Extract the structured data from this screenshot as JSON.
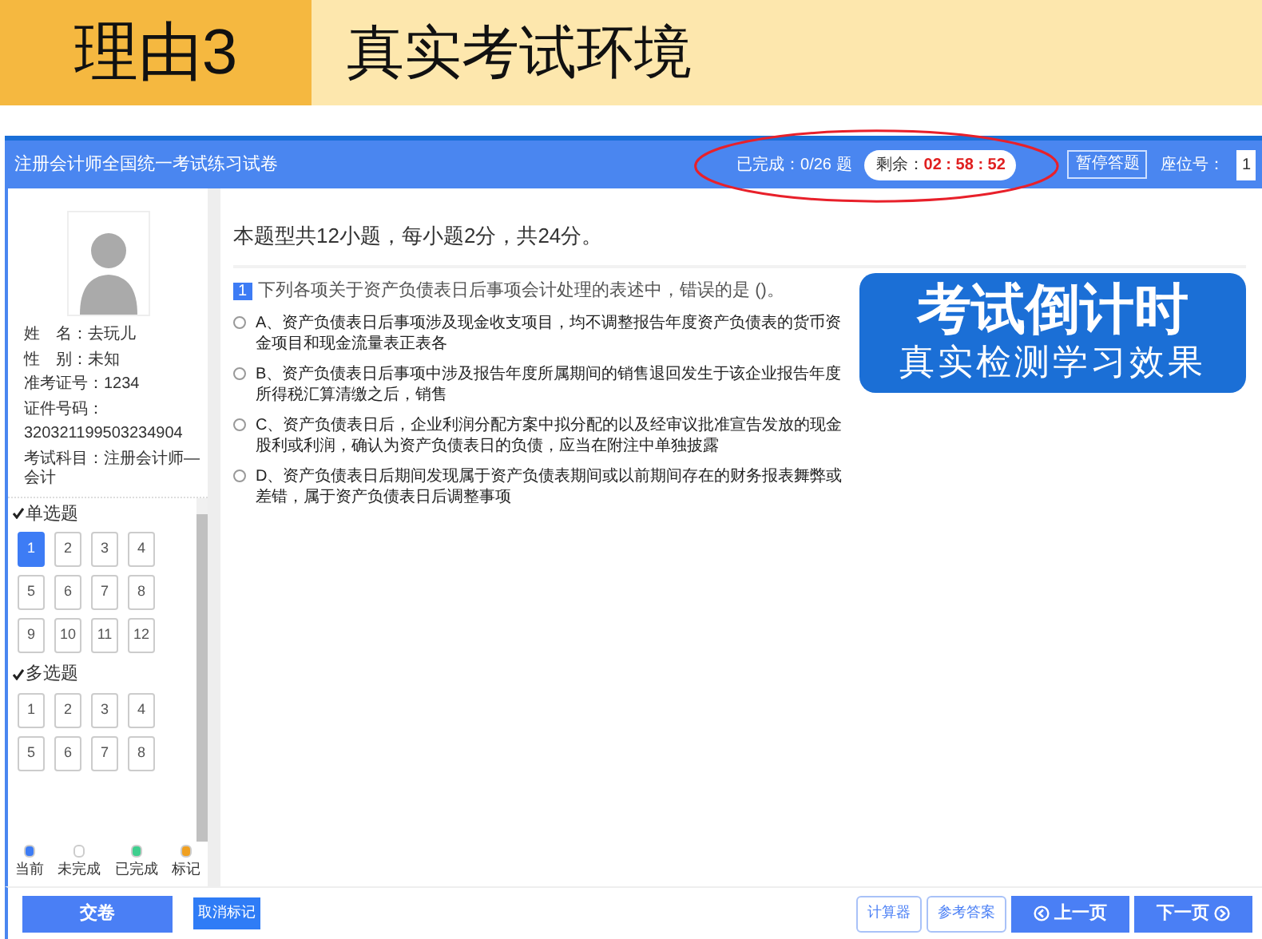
{
  "banner": {
    "tag": "理由3",
    "title": "真实考试环境"
  },
  "header": {
    "title": "注册会计师全国统一考试练习试卷",
    "progress": "已完成：0/26 题",
    "timer_label": "剩余：",
    "timer": "02 : 58 : 52",
    "pause_button": "暂停答题",
    "seat_label": "座位号：",
    "seat": "1"
  },
  "candidate": {
    "lines": [
      "姓　名：去玩儿",
      "性　别：未知",
      "准考证号：1234",
      "证件号码：",
      "320321199503234904",
      "考试科目：注册会计师—会计"
    ]
  },
  "sections": [
    {
      "title": "单选题",
      "expanded": true,
      "questions": [
        {
          "number": "1",
          "selected": true
        },
        {
          "number": "2",
          "selected": false
        },
        {
          "number": "3",
          "selected": false
        },
        {
          "number": "4",
          "selected": false
        },
        {
          "number": "5",
          "selected": false
        },
        {
          "number": "6",
          "selected": false
        },
        {
          "number": "7",
          "selected": false
        },
        {
          "number": "8",
          "selected": false
        },
        {
          "number": "9",
          "selected": false
        },
        {
          "number": "10",
          "selected": false
        },
        {
          "number": "11",
          "selected": false
        },
        {
          "number": "12",
          "selected": false
        }
      ]
    },
    {
      "title": "多选题",
      "expanded": true,
      "questions": [
        {
          "number": "1",
          "selected": false
        },
        {
          "number": "2",
          "selected": false
        },
        {
          "number": "3",
          "selected": false
        },
        {
          "number": "4",
          "selected": false
        },
        {
          "number": "5",
          "selected": false
        },
        {
          "number": "6",
          "selected": false
        },
        {
          "number": "7",
          "selected": false
        },
        {
          "number": "8",
          "selected": false
        }
      ]
    }
  ],
  "legend": [
    {
      "label": "当前",
      "color": "#3d7cf5"
    },
    {
      "label": "未完成",
      "color": "#ffffff"
    },
    {
      "label": "已完成",
      "color": "#3ecf8e"
    },
    {
      "label": "标记",
      "color": "#f0a020"
    }
  ],
  "question": {
    "intro": "本题型共12小题，每小题2分，共24分。",
    "number": "1",
    "text": "下列各项关于资产负债表日后事项会计处理的表述中，错误的是 ()。",
    "options": [
      {
        "text": "A、资产负债表日后事项涉及现金收支项目，均不调整报告年度资产负债表的货币资金项目和现金流量表正表各",
        "selected": false
      },
      {
        "text": "B、资产负债表日后事项中涉及报告年度所属期间的销售退回发生于该企业报告年度所得税汇算清缴之后，销售",
        "selected": false
      },
      {
        "text": "C、资产负债表日后，企业利润分配方案中拟分配的以及经审议批准宣告发放的现金股利或利润，确认为资产负债表日的负债，应当在附注中单独披露",
        "selected": false
      },
      {
        "text": "D、资产负债表日后期间发现属于资产负债表期间或以前期间存在的财务报表舞弊或差错，属于资产负债表日后调整事项",
        "selected": false
      }
    ]
  },
  "promo": {
    "title": "考试倒计时",
    "subtitle": "真实检测学习效果"
  },
  "footer": {
    "submit": "交卷",
    "unmark": "取消标记",
    "calculator": "计算器",
    "answer": "参考答案",
    "prev": "上一页",
    "next": "下一页"
  }
}
